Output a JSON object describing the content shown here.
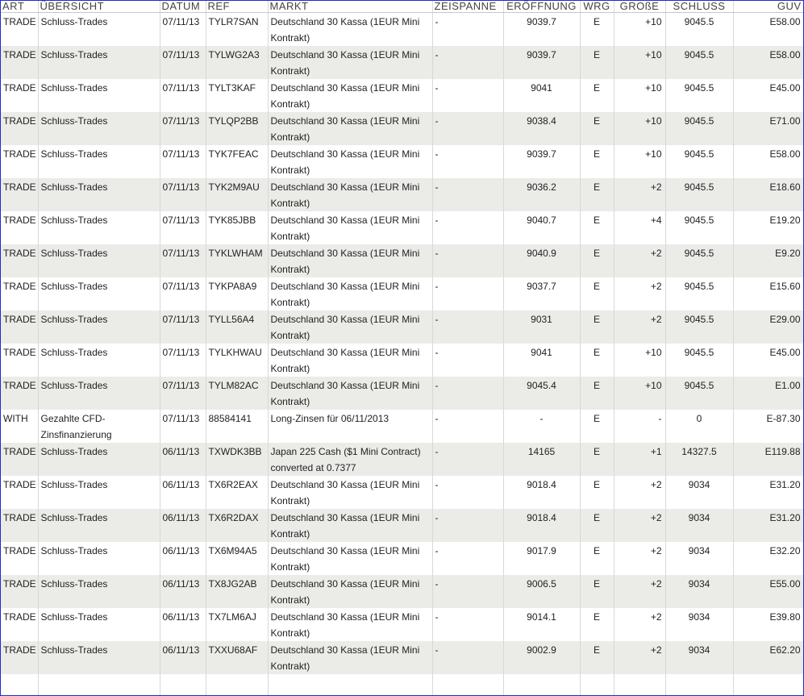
{
  "headers": {
    "art": "ART",
    "uebersicht": "ÜBERSICHT",
    "datum": "DATUM",
    "ref": "REF",
    "markt": "MARKT",
    "zeispanne": "ZEISPANNE",
    "eroeffnung": "ERÖFFNUNG",
    "wrg": "WRG",
    "groesse": "GROßE",
    "schluss": "SCHLUSS",
    "guv": "GUV"
  },
  "rows": [
    {
      "art": "TRADE",
      "uebersicht": "Schluss-Trades",
      "datum": "07/11/13",
      "ref": "TYLR7SAN",
      "markt": "Deutschland 30 Kassa (1EUR Mini Kontrakt)",
      "zeispanne": "-",
      "eroeffnung": "9039.7",
      "wrg": "E",
      "groesse": "+10",
      "schluss": "9045.5",
      "guv": "E58.00"
    },
    {
      "art": "TRADE",
      "uebersicht": "Schluss-Trades",
      "datum": "07/11/13",
      "ref": "TYLWG2A3",
      "markt": "Deutschland 30 Kassa (1EUR Mini Kontrakt)",
      "zeispanne": "-",
      "eroeffnung": "9039.7",
      "wrg": "E",
      "groesse": "+10",
      "schluss": "9045.5",
      "guv": "E58.00"
    },
    {
      "art": "TRADE",
      "uebersicht": "Schluss-Trades",
      "datum": "07/11/13",
      "ref": "TYLT3KAF",
      "markt": "Deutschland 30 Kassa (1EUR Mini Kontrakt)",
      "zeispanne": "-",
      "eroeffnung": "9041",
      "wrg": "E",
      "groesse": "+10",
      "schluss": "9045.5",
      "guv": "E45.00"
    },
    {
      "art": "TRADE",
      "uebersicht": "Schluss-Trades",
      "datum": "07/11/13",
      "ref": "TYLQP2BB",
      "markt": "Deutschland 30 Kassa (1EUR Mini Kontrakt)",
      "zeispanne": "-",
      "eroeffnung": "9038.4",
      "wrg": "E",
      "groesse": "+10",
      "schluss": "9045.5",
      "guv": "E71.00"
    },
    {
      "art": "TRADE",
      "uebersicht": "Schluss-Trades",
      "datum": "07/11/13",
      "ref": "TYK7FEAC",
      "markt": "Deutschland 30 Kassa (1EUR Mini Kontrakt)",
      "zeispanne": "-",
      "eroeffnung": "9039.7",
      "wrg": "E",
      "groesse": "+10",
      "schluss": "9045.5",
      "guv": "E58.00"
    },
    {
      "art": "TRADE",
      "uebersicht": "Schluss-Trades",
      "datum": "07/11/13",
      "ref": "TYK2M9AU",
      "markt": "Deutschland 30 Kassa (1EUR Mini Kontrakt)",
      "zeispanne": "-",
      "eroeffnung": "9036.2",
      "wrg": "E",
      "groesse": "+2",
      "schluss": "9045.5",
      "guv": "E18.60"
    },
    {
      "art": "TRADE",
      "uebersicht": "Schluss-Trades",
      "datum": "07/11/13",
      "ref": "TYK85JBB",
      "markt": "Deutschland 30 Kassa (1EUR Mini Kontrakt)",
      "zeispanne": "-",
      "eroeffnung": "9040.7",
      "wrg": "E",
      "groesse": "+4",
      "schluss": "9045.5",
      "guv": "E19.20"
    },
    {
      "art": "TRADE",
      "uebersicht": "Schluss-Trades",
      "datum": "07/11/13",
      "ref": "TYKLWHAM",
      "markt": "Deutschland 30 Kassa (1EUR Mini Kontrakt)",
      "zeispanne": "-",
      "eroeffnung": "9040.9",
      "wrg": "E",
      "groesse": "+2",
      "schluss": "9045.5",
      "guv": "E9.20"
    },
    {
      "art": "TRADE",
      "uebersicht": "Schluss-Trades",
      "datum": "07/11/13",
      "ref": "TYKPA8A9",
      "markt": "Deutschland 30 Kassa (1EUR Mini Kontrakt)",
      "zeispanne": "-",
      "eroeffnung": "9037.7",
      "wrg": "E",
      "groesse": "+2",
      "schluss": "9045.5",
      "guv": "E15.60"
    },
    {
      "art": "TRADE",
      "uebersicht": "Schluss-Trades",
      "datum": "07/11/13",
      "ref": "TYLL56A4",
      "markt": "Deutschland 30 Kassa (1EUR Mini Kontrakt)",
      "zeispanne": "-",
      "eroeffnung": "9031",
      "wrg": "E",
      "groesse": "+2",
      "schluss": "9045.5",
      "guv": "E29.00"
    },
    {
      "art": "TRADE",
      "uebersicht": "Schluss-Trades",
      "datum": "07/11/13",
      "ref": "TYLKHWAU",
      "markt": "Deutschland 30 Kassa (1EUR Mini Kontrakt)",
      "zeispanne": "-",
      "eroeffnung": "9041",
      "wrg": "E",
      "groesse": "+10",
      "schluss": "9045.5",
      "guv": "E45.00"
    },
    {
      "art": "TRADE",
      "uebersicht": "Schluss-Trades",
      "datum": "07/11/13",
      "ref": "TYLM82AC",
      "markt": "Deutschland 30 Kassa (1EUR Mini Kontrakt)",
      "zeispanne": "-",
      "eroeffnung": "9045.4",
      "wrg": "E",
      "groesse": "+10",
      "schluss": "9045.5",
      "guv": "E1.00"
    },
    {
      "art": "WITH",
      "uebersicht": "Gezahlte CFD-Zinsfinanzierung",
      "datum": "07/11/13",
      "ref": "88584141",
      "markt": "Long-Zinsen für 06/11/2013",
      "zeispanne": "-",
      "eroeffnung": "-",
      "wrg": "E",
      "groesse": "-",
      "schluss": "0",
      "guv": "E-87.30"
    },
    {
      "art": "TRADE",
      "uebersicht": "Schluss-Trades",
      "datum": "06/11/13",
      "ref": "TXWDK3BB",
      "markt": "Japan 225 Cash ($1 Mini Contract) converted at 0.7377",
      "zeispanne": "-",
      "eroeffnung": "14165",
      "wrg": "E",
      "groesse": "+1",
      "schluss": "14327.5",
      "guv": "E119.88"
    },
    {
      "art": "TRADE",
      "uebersicht": "Schluss-Trades",
      "datum": "06/11/13",
      "ref": "TX6R2EAX",
      "markt": "Deutschland 30 Kassa (1EUR Mini Kontrakt)",
      "zeispanne": "-",
      "eroeffnung": "9018.4",
      "wrg": "E",
      "groesse": "+2",
      "schluss": "9034",
      "guv": "E31.20"
    },
    {
      "art": "TRADE",
      "uebersicht": "Schluss-Trades",
      "datum": "06/11/13",
      "ref": "TX6R2DAX",
      "markt": "Deutschland 30 Kassa (1EUR Mini Kontrakt)",
      "zeispanne": "-",
      "eroeffnung": "9018.4",
      "wrg": "E",
      "groesse": "+2",
      "schluss": "9034",
      "guv": "E31.20"
    },
    {
      "art": "TRADE",
      "uebersicht": "Schluss-Trades",
      "datum": "06/11/13",
      "ref": "TX6M94A5",
      "markt": "Deutschland 30 Kassa (1EUR Mini Kontrakt)",
      "zeispanne": "-",
      "eroeffnung": "9017.9",
      "wrg": "E",
      "groesse": "+2",
      "schluss": "9034",
      "guv": "E32.20"
    },
    {
      "art": "TRADE",
      "uebersicht": "Schluss-Trades",
      "datum": "06/11/13",
      "ref": "TX8JG2AB",
      "markt": "Deutschland 30 Kassa (1EUR Mini Kontrakt)",
      "zeispanne": "-",
      "eroeffnung": "9006.5",
      "wrg": "E",
      "groesse": "+2",
      "schluss": "9034",
      "guv": "E55.00"
    },
    {
      "art": "TRADE",
      "uebersicht": "Schluss-Trades",
      "datum": "06/11/13",
      "ref": "TX7LM6AJ",
      "markt": "Deutschland 30 Kassa (1EUR Mini Kontrakt)",
      "zeispanne": "-",
      "eroeffnung": "9014.1",
      "wrg": "E",
      "groesse": "+2",
      "schluss": "9034",
      "guv": "E39.80"
    },
    {
      "art": "TRADE",
      "uebersicht": "Schluss-Trades",
      "datum": "06/11/13",
      "ref": "TXXU68AF",
      "markt": "Deutschland 30 Kassa (1EUR Mini Kontrakt)",
      "zeispanne": "-",
      "eroeffnung": "9002.9",
      "wrg": "E",
      "groesse": "+2",
      "schluss": "9034",
      "guv": "E62.20"
    }
  ]
}
